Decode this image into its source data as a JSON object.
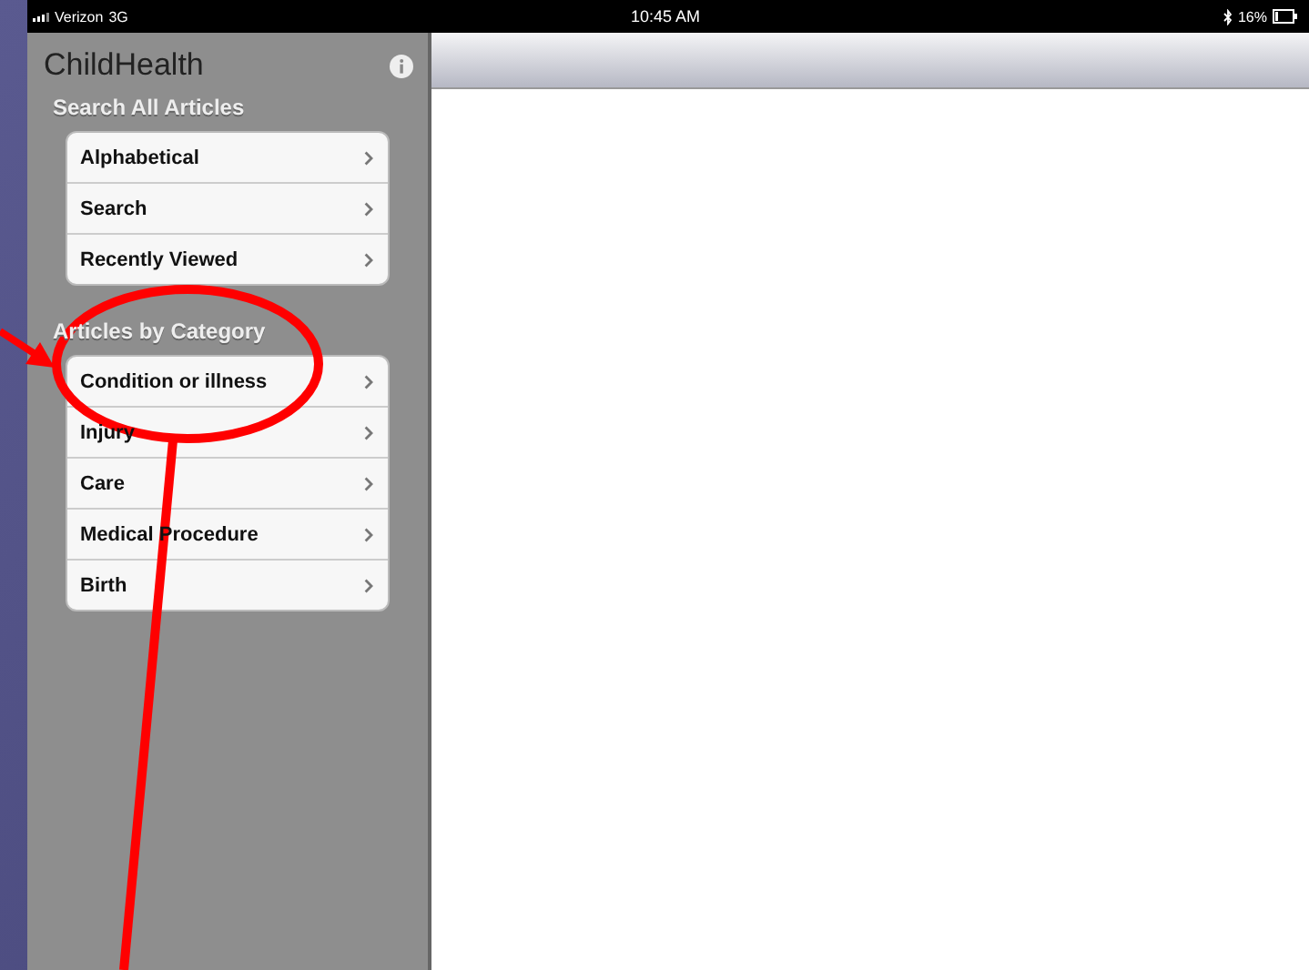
{
  "status_bar": {
    "carrier": "Verizon",
    "network": "3G",
    "time": "10:45 AM",
    "battery": "16%"
  },
  "sidebar": {
    "title": "ChildHealth",
    "sections": [
      {
        "heading": "Search All Articles",
        "items": [
          {
            "label": "Alphabetical"
          },
          {
            "label": "Search"
          },
          {
            "label": "Recently Viewed"
          }
        ]
      },
      {
        "heading": "Articles by Category",
        "items": [
          {
            "label": "Condition or illness"
          },
          {
            "label": "Injury"
          },
          {
            "label": "Care"
          },
          {
            "label": "Medical Procedure"
          },
          {
            "label": "Birth"
          }
        ]
      }
    ]
  }
}
